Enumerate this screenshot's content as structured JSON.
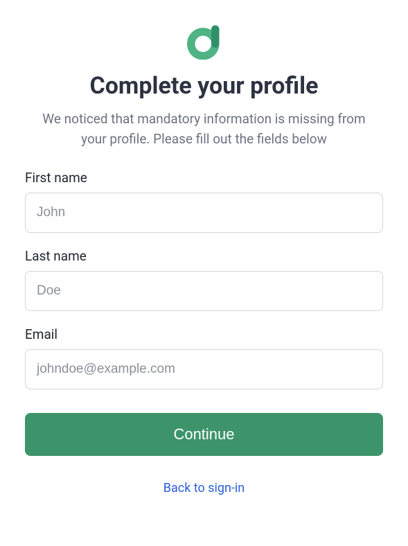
{
  "header": {
    "title": "Complete your profile",
    "subtitle": "We noticed that mandatory information is missing from your profile. Please fill out the fields below"
  },
  "form": {
    "first_name": {
      "label": "First name",
      "placeholder": "John",
      "value": ""
    },
    "last_name": {
      "label": "Last name",
      "placeholder": "Doe",
      "value": ""
    },
    "email": {
      "label": "Email",
      "placeholder": "johndoe@example.com",
      "value": ""
    },
    "submit_label": "Continue"
  },
  "footer": {
    "back_link": "Back to sign-in"
  },
  "colors": {
    "accent": "#3d946b",
    "link": "#2d5fd8",
    "title": "#2d3340",
    "muted": "#6b7280"
  }
}
